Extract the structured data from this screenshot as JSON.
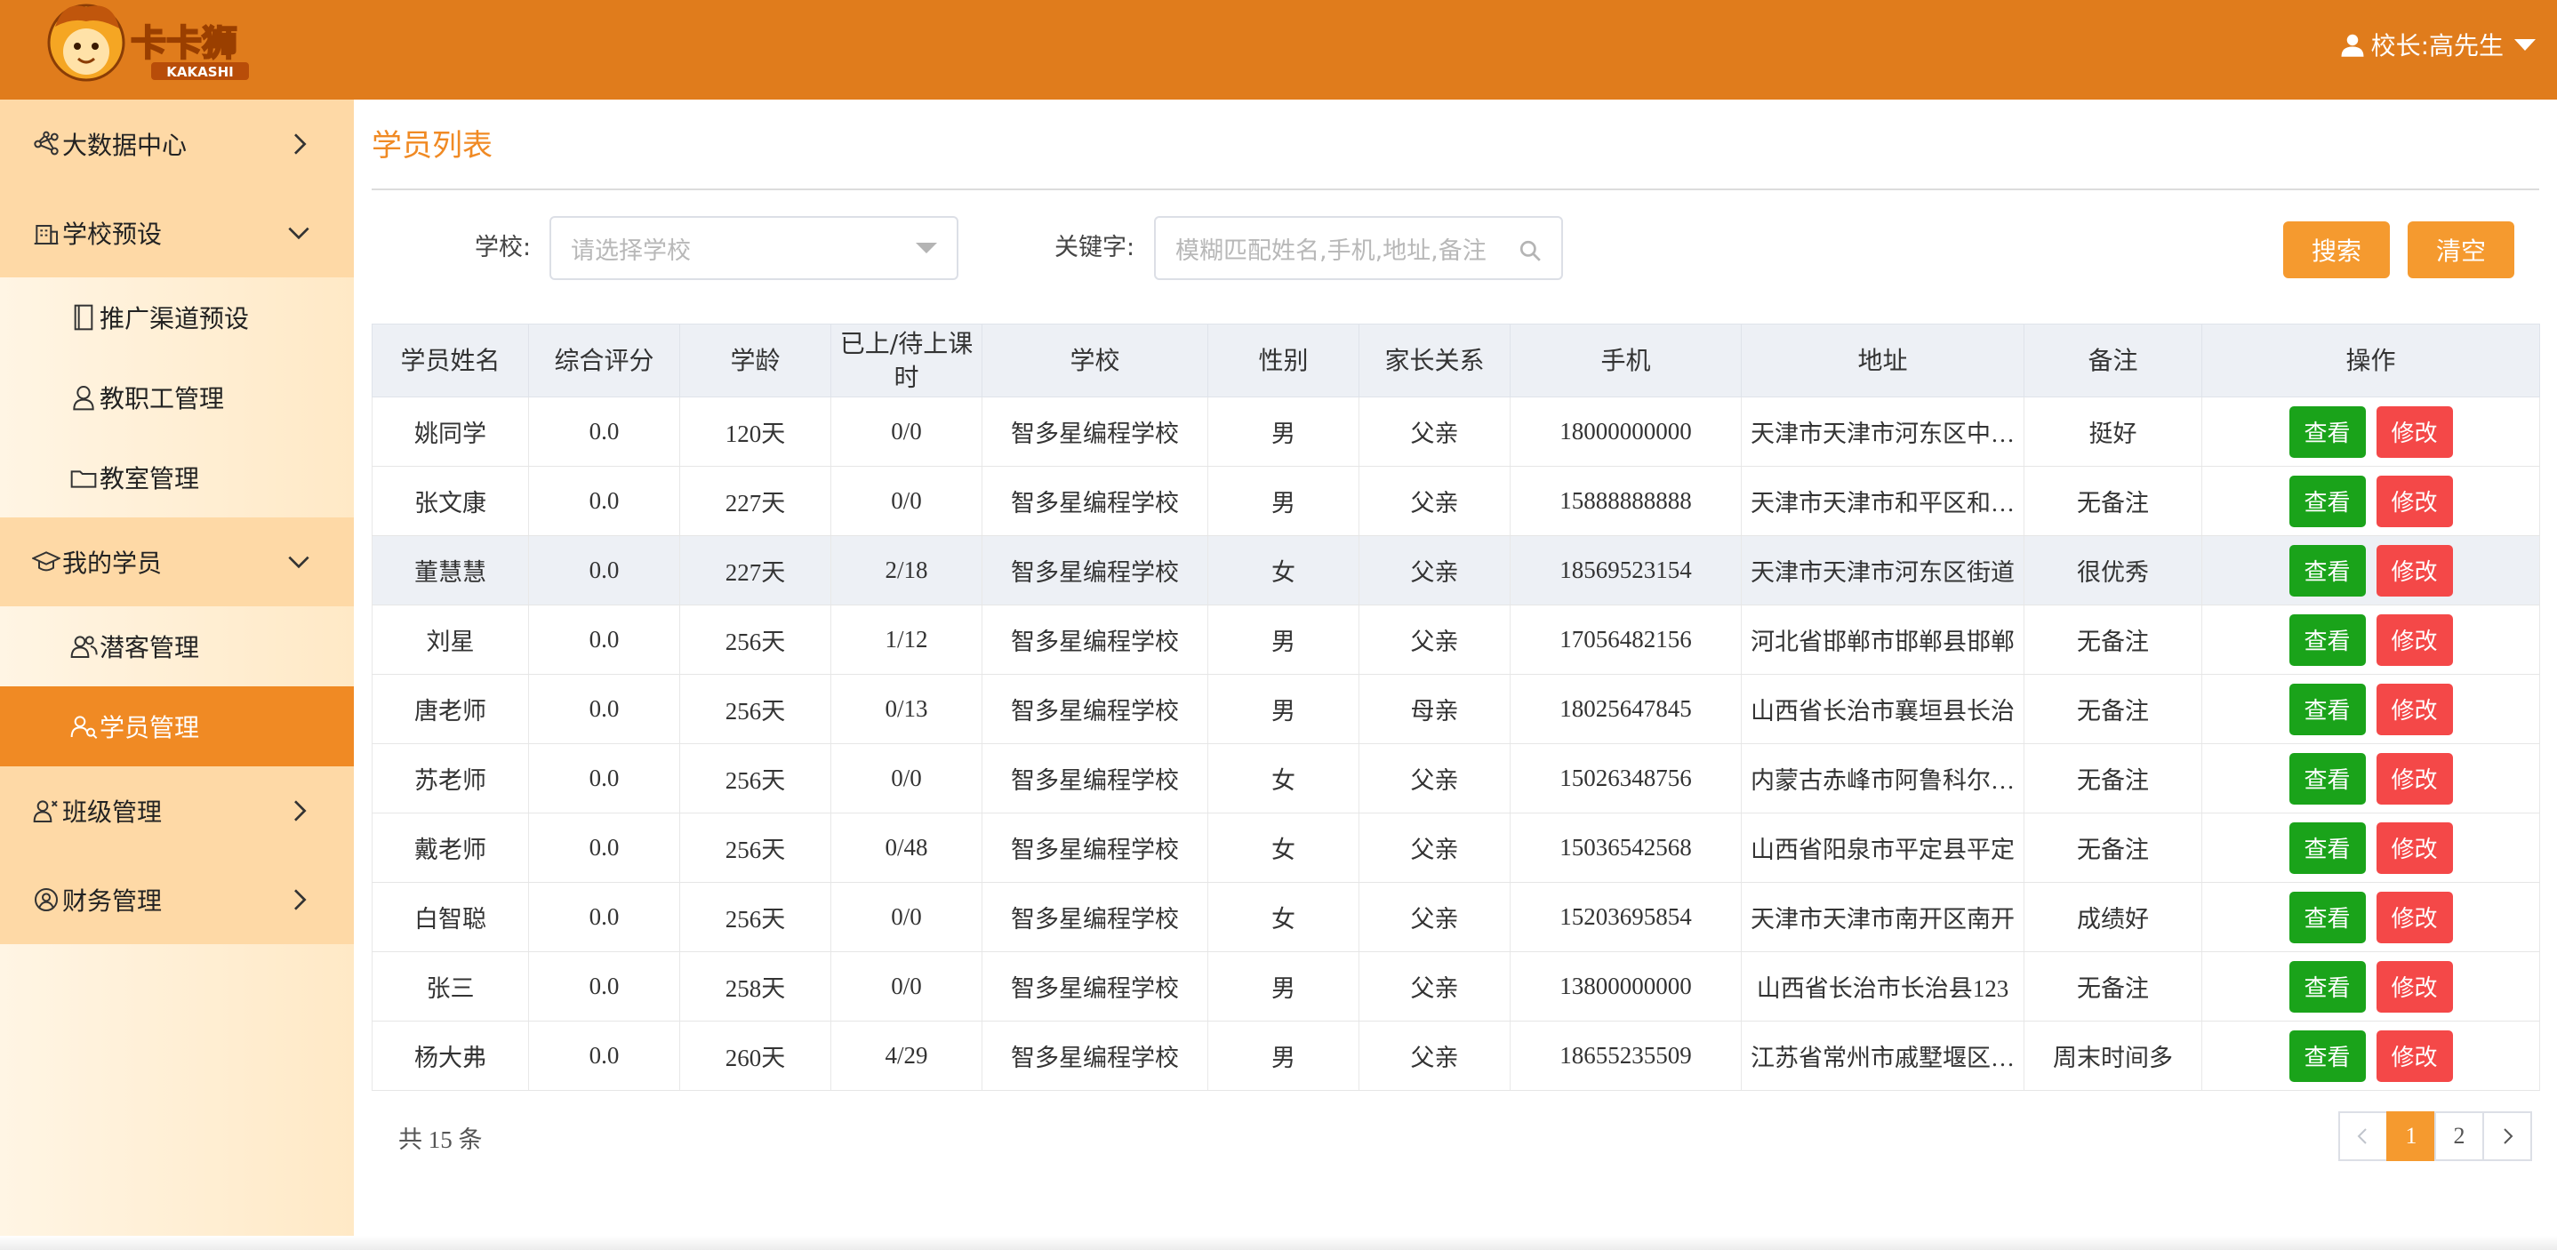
{
  "header": {
    "logo_text": "卡卡狮",
    "logo_sub": "KAKASHI",
    "user_label": "校长:高先生",
    "bg_color": "#e07c1c"
  },
  "sidebar": {
    "groups": [
      {
        "label": "大数据中心",
        "icon": "network-icon",
        "expanded": false
      },
      {
        "label": "学校预设",
        "icon": "building-icon",
        "expanded": true,
        "items": [
          {
            "label": "推广渠道预设",
            "icon": "book-icon"
          },
          {
            "label": "教职工管理",
            "icon": "person-icon"
          },
          {
            "label": "教室管理",
            "icon": "folder-icon"
          }
        ]
      },
      {
        "label": "我的学员",
        "icon": "graduation-cap-icon",
        "expanded": true,
        "items": [
          {
            "label": "潜客管理",
            "icon": "users-icon"
          },
          {
            "label": "学员管理",
            "icon": "user-group-icon",
            "active": true
          }
        ]
      },
      {
        "label": "班级管理",
        "icon": "class-icon",
        "expanded": false
      },
      {
        "label": "财务管理",
        "icon": "finance-icon",
        "expanded": false
      }
    ],
    "active_color": "#f08a24"
  },
  "page": {
    "title": "学员列表"
  },
  "filters": {
    "school_label": "学校:",
    "school_placeholder": "请选择学校",
    "keyword_label": "关键字:",
    "keyword_placeholder": "模糊匹配姓名,手机,地址,备注",
    "search_button": "搜索",
    "clear_button": "清空"
  },
  "table": {
    "columns": [
      "学员姓名",
      "综合评分",
      "学龄",
      "已上/待上课时",
      "学校",
      "性别",
      "家长关系",
      "手机",
      "地址",
      "备注",
      "操作"
    ],
    "rows": [
      {
        "name": "姚同学",
        "score": "0.0",
        "age": "120天",
        "hours": "0/0",
        "school": "智多星编程学校",
        "gender": "男",
        "relation": "父亲",
        "phone": "18000000000",
        "address": "天津市天津市河东区中…",
        "note": "挺好"
      },
      {
        "name": "张文康",
        "score": "0.0",
        "age": "227天",
        "hours": "0/0",
        "school": "智多星编程学校",
        "gender": "男",
        "relation": "父亲",
        "phone": "15888888888",
        "address": "天津市天津市和平区和…",
        "note": "无备注"
      },
      {
        "name": "董慧慧",
        "score": "0.0",
        "age": "227天",
        "hours": "2/18",
        "school": "智多星编程学校",
        "gender": "女",
        "relation": "父亲",
        "phone": "18569523154",
        "address": "天津市天津市河东区街道",
        "note": "很优秀",
        "highlight": true
      },
      {
        "name": "刘星",
        "score": "0.0",
        "age": "256天",
        "hours": "1/12",
        "school": "智多星编程学校",
        "gender": "男",
        "relation": "父亲",
        "phone": "17056482156",
        "address": "河北省邯郸市邯郸县邯郸",
        "note": "无备注"
      },
      {
        "name": "唐老师",
        "score": "0.0",
        "age": "256天",
        "hours": "0/13",
        "school": "智多星编程学校",
        "gender": "男",
        "relation": "母亲",
        "phone": "18025647845",
        "address": "山西省长治市襄垣县长治",
        "note": "无备注"
      },
      {
        "name": "苏老师",
        "score": "0.0",
        "age": "256天",
        "hours": "0/0",
        "school": "智多星编程学校",
        "gender": "女",
        "relation": "父亲",
        "phone": "15026348756",
        "address": "内蒙古赤峰市阿鲁科尔…",
        "note": "无备注"
      },
      {
        "name": "戴老师",
        "score": "0.0",
        "age": "256天",
        "hours": "0/48",
        "school": "智多星编程学校",
        "gender": "女",
        "relation": "父亲",
        "phone": "15036542568",
        "address": "山西省阳泉市平定县平定",
        "note": "无备注"
      },
      {
        "name": "白智聪",
        "score": "0.0",
        "age": "256天",
        "hours": "0/0",
        "school": "智多星编程学校",
        "gender": "女",
        "relation": "父亲",
        "phone": "15203695854",
        "address": "天津市天津市南开区南开",
        "note": "成绩好"
      },
      {
        "name": "张三",
        "score": "0.0",
        "age": "258天",
        "hours": "0/0",
        "school": "智多星编程学校",
        "gender": "男",
        "relation": "父亲",
        "phone": "13800000000",
        "address": "山西省长治市长治县123",
        "note": "无备注"
      },
      {
        "name": "杨大弗",
        "score": "0.0",
        "age": "260天",
        "hours": "4/29",
        "school": "智多星编程学校",
        "gender": "男",
        "relation": "父亲",
        "phone": "18655235509",
        "address": "江苏省常州市戚墅堰区…",
        "note": "周末时间多"
      }
    ],
    "view_label": "查看",
    "edit_label": "修改"
  },
  "pagination": {
    "total_text": "共 15 条",
    "pages": [
      "1",
      "2"
    ],
    "current": "1"
  }
}
